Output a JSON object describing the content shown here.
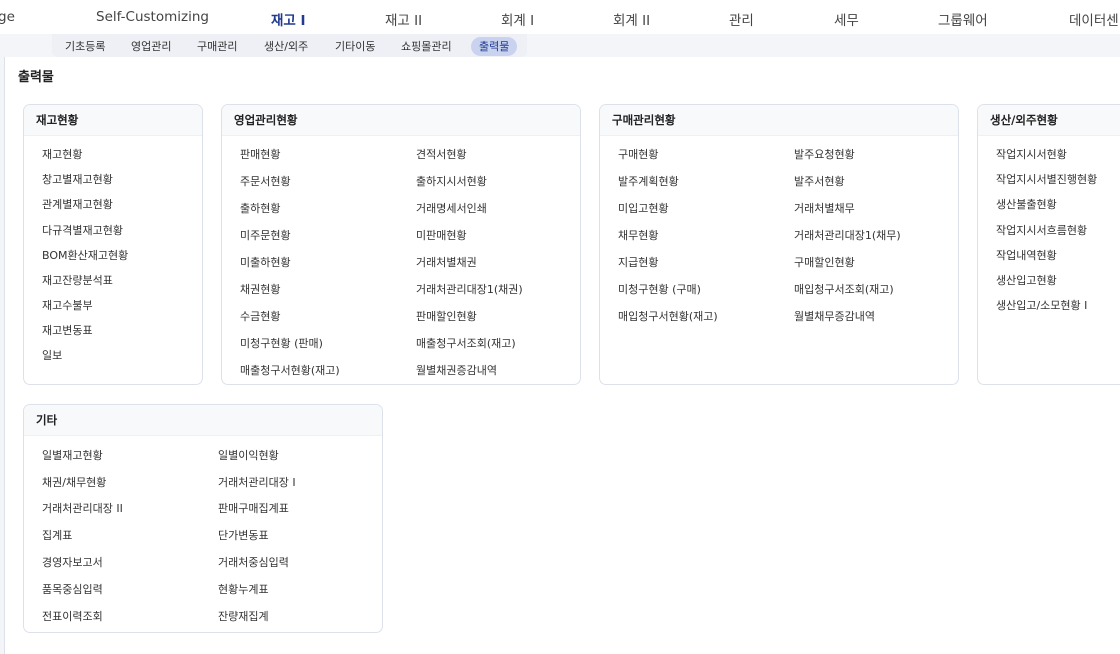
{
  "top_nav": [
    "ge",
    "Self-Customizing",
    "재고 I",
    "재고 II",
    "회계 I",
    "회계 II",
    "관리",
    "세무",
    "그룹웨어",
    "데이터센"
  ],
  "sub_nav": [
    "기초등록",
    "영업관리",
    "구매관리",
    "생산/외주",
    "기타이동",
    "쇼핑몰관리",
    "출력물"
  ],
  "page_title": "출력물",
  "cards": [
    {
      "title": "재고현황",
      "items": [
        "재고현황",
        "창고별재고현황",
        "관계별재고현황",
        "다규격별재고현황",
        "BOM환산재고현황",
        "재고잔량분석표",
        "재고수불부",
        "재고변동표",
        "일보"
      ]
    },
    {
      "title": "영업관리현황",
      "items": [
        "판매현황",
        "견적서현황",
        "주문서현황",
        "출하지시서현황",
        "출하현황",
        "거래명세서인쇄",
        "미주문현황",
        "미판매현황",
        "미출하현황",
        "거래처별채권",
        "채권현황",
        "거래처관리대장1(채권)",
        "수금현황",
        "판매할인현황",
        "미청구현황 (판매)",
        "매출청구서조회(재고)",
        "매출청구서현황(재고)",
        "월별채권증감내역"
      ]
    },
    {
      "title": "구매관리현황",
      "items": [
        "구매현황",
        "발주요청현황",
        "발주계획현황",
        "발주서현황",
        "미입고현황",
        "거래처별채무",
        "채무현황",
        "거래처관리대장1(채무)",
        "지급현황",
        "구매할인현황",
        "미청구현황 (구매)",
        "매입청구서조회(재고)",
        "매입청구서현황(재고)",
        "월별채무증감내역"
      ]
    },
    {
      "title": "생산/외주현황",
      "items": [
        "작업지시서현황",
        "작업지시서별진행현황",
        "생산불출현황",
        "작업지시서흐름현황",
        "작업내역현황",
        "생산입고현황",
        "생산입고/소모현황 I"
      ]
    },
    {
      "title": "기타",
      "items": [
        "일별재고현황",
        "일별이익현황",
        "채권/채무현황",
        "거래처관리대장 I",
        "거래처관리대장 II",
        "판매구매집계표",
        "집계표",
        "단가변동표",
        "경영자보고서",
        "거래처중심입력",
        "품목중심입력",
        "현황누계표",
        "전표이력조회",
        "잔량재집계"
      ]
    }
  ]
}
